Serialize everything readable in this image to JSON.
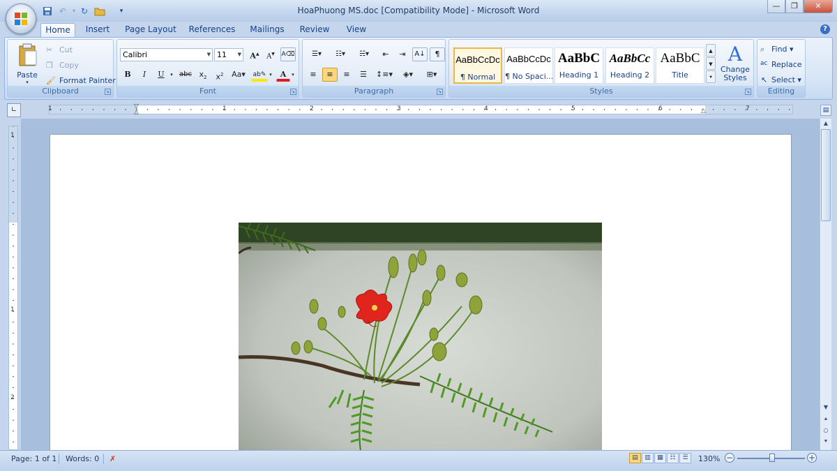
{
  "window": {
    "title": "HoaPhuong MS.doc [Compatibility Mode] - Microsoft Word"
  },
  "tabs": [
    {
      "label": "Home"
    },
    {
      "label": "Insert"
    },
    {
      "label": "Page Layout"
    },
    {
      "label": "References"
    },
    {
      "label": "Mailings"
    },
    {
      "label": "Review"
    },
    {
      "label": "View"
    }
  ],
  "clipboard": {
    "paste": "Paste",
    "cut": "Cut",
    "copy": "Copy",
    "format_painter": "Format Painter",
    "label": "Clipboard"
  },
  "font": {
    "family": "Calibri",
    "size": "11",
    "label": "Font"
  },
  "paragraph": {
    "label": "Paragraph"
  },
  "styles": {
    "label": "Styles",
    "items": [
      {
        "sample": "AaBbCcDc",
        "name": "¶ Normal"
      },
      {
        "sample": "AaBbCcDc",
        "name": "¶ No Spaci..."
      },
      {
        "sample": "AaBbC",
        "name": "Heading 1"
      },
      {
        "sample": "AaBbCc",
        "name": "Heading 2"
      },
      {
        "sample": "AaBbC",
        "name": "Title"
      }
    ],
    "change": "Change Styles"
  },
  "editing": {
    "find": "Find",
    "replace": "Replace",
    "select": "Select",
    "label": "Editing"
  },
  "ruler": {
    "h_numbers": [
      "1",
      "1",
      "2",
      "3",
      "4",
      "5",
      "6",
      "7"
    ],
    "v_numbers": [
      "1",
      "1",
      "2"
    ]
  },
  "status": {
    "page": "Page: 1 of 1",
    "words": "Words: 0",
    "zoom": "130%"
  }
}
